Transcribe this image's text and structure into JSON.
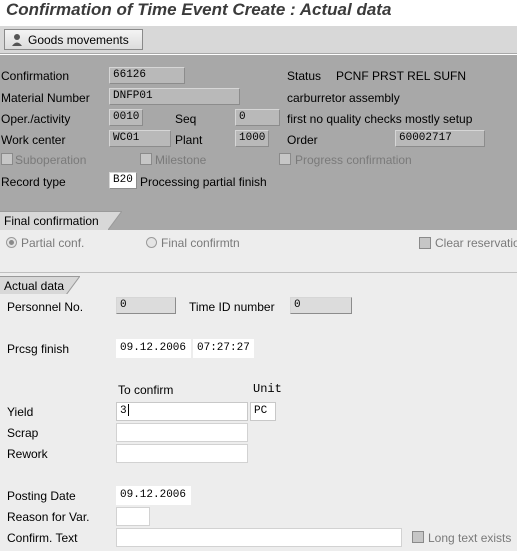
{
  "window": {
    "title": "Confirmation of Time Event Create : Actual data"
  },
  "toolbar": {
    "goods_movements_label": "Goods movements"
  },
  "header": {
    "confirmation_label": "Confirmation",
    "confirmation_value": "66126",
    "status_label": "Status",
    "status_value": "PCNF PRST REL  SUFN",
    "material_label": "Material Number",
    "material_value": "DNFP01",
    "material_desc": "carburretor assembly",
    "oper_label": "Oper./activity",
    "oper_value": "0010",
    "seq_label": "Seq",
    "seq_value": "0",
    "oper_desc": "first no quality checks mostly setup",
    "workcenter_label": "Work center",
    "workcenter_value": "WC01",
    "plant_label": "Plant",
    "plant_value": "1000",
    "order_label": "Order",
    "order_value": "60002717",
    "suboperation_label": "Suboperation",
    "milestone_label": "Milestone",
    "progress_label": "Progress confirmation",
    "recordtype_label": "Record type",
    "recordtype_value": "B20",
    "recordtype_desc": "Processing partial finish"
  },
  "final_confirmation": {
    "tab_label": "Final confirmation",
    "partial_label": "Partial conf.",
    "final_label": "Final confirmtn",
    "clear_label": "Clear reservatio"
  },
  "actual_data": {
    "tab_label": "Actual data",
    "personnel_label": "Personnel No.",
    "personnel_value": "0",
    "timeid_label": "Time ID number",
    "timeid_value": "0",
    "prcsg_label": "Prcsg finish",
    "prcsg_date": "09.12.2006",
    "prcsg_time": "07:27:27",
    "to_confirm_header": "To confirm",
    "unit_header": "Unit",
    "yield_label": "Yield",
    "yield_value": "3",
    "yield_unit": "PC",
    "scrap_label": "Scrap",
    "rework_label": "Rework",
    "posting_label": "Posting Date",
    "posting_value": "09.12.2006",
    "reason_label": "Reason for Var.",
    "confirm_text_label": "Confirm. Text",
    "long_text_label": "Long text exists"
  }
}
